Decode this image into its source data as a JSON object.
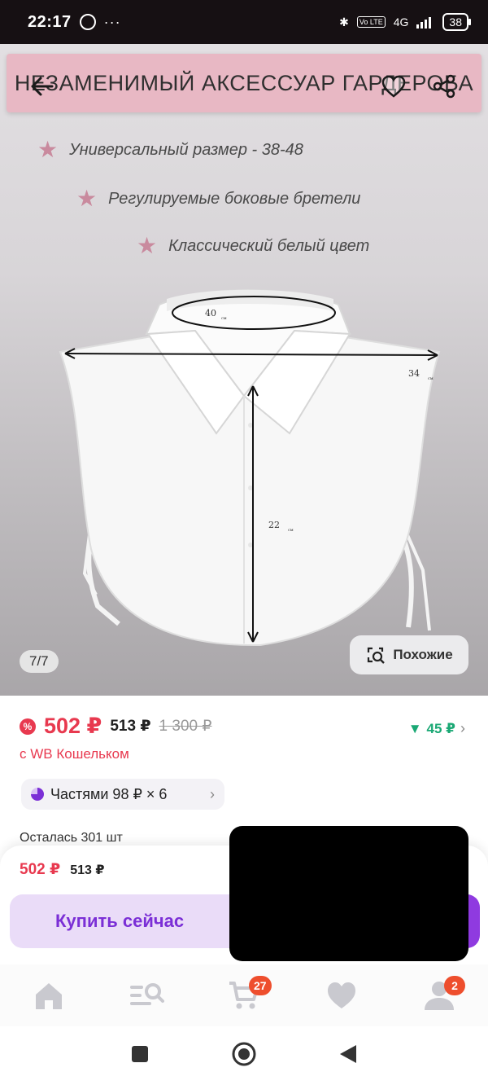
{
  "status_bar": {
    "time": "22:17",
    "dots": "···",
    "volte": "Vo LTE",
    "network": "4G",
    "battery": "38"
  },
  "hero": {
    "banner_title": "НЕЗАМЕНИМЫЙ АКСЕССУАР ГАРДЕРОБА",
    "features": [
      "Универсальный размер - 38-48",
      "Регулируемые боковые бретели",
      "Классический белый цвет"
    ],
    "measure_labels": {
      "neck": "40",
      "width": "34",
      "length": "22",
      "unit": "см"
    },
    "counter": "7/7",
    "similar_label": "Похожие"
  },
  "price": {
    "current": "502 ₽",
    "regular": "513 ₽",
    "old": "1 300 ₽",
    "wallet_label": "с WB Кошельком",
    "drop": "45 ₽"
  },
  "installments": {
    "label": "Частями 98 ₽ × 6"
  },
  "stock": {
    "label": "Осталась 301 шт"
  },
  "buy_sheet": {
    "price": "502 ₽",
    "regular": "513 ₽",
    "buy_label": "Купить сейчас"
  },
  "tabbar": {
    "cart_badge": "27",
    "profile_badge": "2"
  },
  "colors": {
    "accent": "#7b2fd6",
    "sale": "#e8394f",
    "green": "#1aa874",
    "banner": "#e8b8c4"
  }
}
